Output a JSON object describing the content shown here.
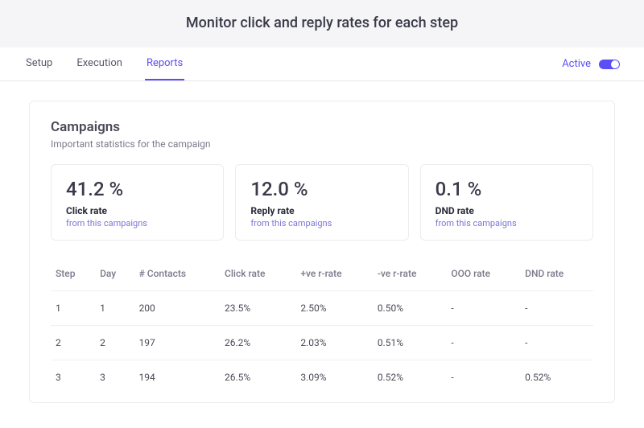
{
  "hero": {
    "title": "Monitor click and reply rates for each step"
  },
  "tabs": {
    "items": [
      {
        "label": "Setup"
      },
      {
        "label": "Execution"
      },
      {
        "label": "Reports"
      }
    ],
    "active_index": 2,
    "status_label": "Active"
  },
  "panel": {
    "title": "Campaigns",
    "subtitle": "Important statistics for the campaign",
    "cards": [
      {
        "value": "41.2 %",
        "label": "Click rate",
        "sub": "from this campaigns"
      },
      {
        "value": "12.0 %",
        "label": "Reply rate",
        "sub": "from this campaigns"
      },
      {
        "value": "0.1 %",
        "label": "DND rate",
        "sub": "from this campaigns"
      }
    ],
    "table": {
      "headers": [
        "Step",
        "Day",
        "# Contacts",
        "Click rate",
        "+ve r-rate",
        "-ve r-rate",
        "OOO rate",
        "DND rate"
      ],
      "rows": [
        [
          "1",
          "1",
          "200",
          "23.5%",
          "2.50%",
          "0.50%",
          "-",
          "-"
        ],
        [
          "2",
          "2",
          "197",
          "26.2%",
          "2.03%",
          "0.51%",
          "-",
          "-"
        ],
        [
          "3",
          "3",
          "194",
          "26.5%",
          "3.09%",
          "0.52%",
          "-",
          "0.52%"
        ]
      ]
    }
  },
  "chart_data": {
    "type": "table",
    "title": "Campaigns — Important statistics for the campaign",
    "summary": [
      {
        "metric": "Click rate",
        "value": 41.2,
        "unit": "%"
      },
      {
        "metric": "Reply rate",
        "value": 12.0,
        "unit": "%"
      },
      {
        "metric": "DND rate",
        "value": 0.1,
        "unit": "%"
      }
    ],
    "columns": [
      "Step",
      "Day",
      "# Contacts",
      "Click rate",
      "+ve r-rate",
      "-ve r-rate",
      "OOO rate",
      "DND rate"
    ],
    "rows": [
      {
        "step": 1,
        "day": 1,
        "contacts": 200,
        "click_rate": 23.5,
        "pos_reply_rate": 2.5,
        "neg_reply_rate": 0.5,
        "ooo_rate": null,
        "dnd_rate": null
      },
      {
        "step": 2,
        "day": 2,
        "contacts": 197,
        "click_rate": 26.2,
        "pos_reply_rate": 2.03,
        "neg_reply_rate": 0.51,
        "ooo_rate": null,
        "dnd_rate": null
      },
      {
        "step": 3,
        "day": 3,
        "contacts": 194,
        "click_rate": 26.5,
        "pos_reply_rate": 3.09,
        "neg_reply_rate": 0.52,
        "ooo_rate": null,
        "dnd_rate": 0.52
      }
    ]
  }
}
